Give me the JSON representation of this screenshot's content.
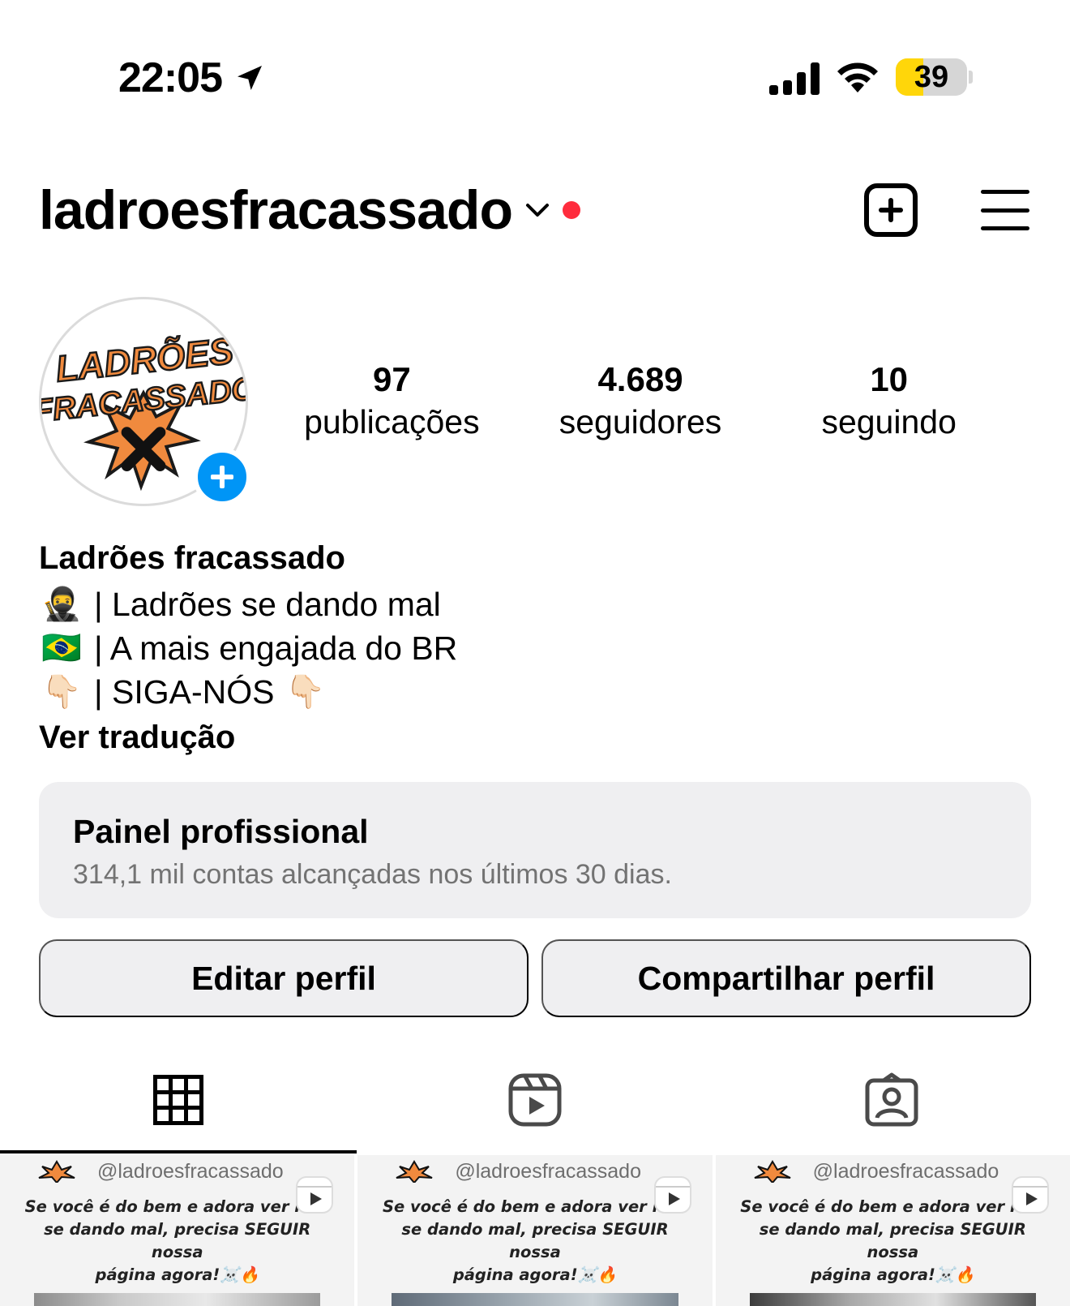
{
  "status_bar": {
    "time": "22:05",
    "battery": "39",
    "battery_level": 0.39
  },
  "header": {
    "username": "ladroesfracassado"
  },
  "profile": {
    "avatar_text": "LADRÕES FRACASSADO",
    "stats": [
      {
        "num": "97",
        "label": "publicações"
      },
      {
        "num": "4.689",
        "label": "seguidores"
      },
      {
        "num": "10",
        "label": "seguindo"
      }
    ]
  },
  "bio": {
    "name": "Ladrões fracassado",
    "lines": [
      {
        "emoji": "🥷",
        "text": "| Ladrões se dando mal",
        "emoji_after": ""
      },
      {
        "emoji": "🇧🇷",
        "text": "| A mais engajada do BR",
        "emoji_after": ""
      },
      {
        "emoji": "👇🏻",
        "text": "| SIGA-NÓS",
        "emoji_after": "👇🏻"
      }
    ],
    "translate": "Ver tradução"
  },
  "panel": {
    "title": "Painel profissional",
    "subtitle": "314,1 mil contas alcançadas nos últimos 30 dias."
  },
  "actions": {
    "edit": "Editar perfil",
    "share": "Compartilhar perfil"
  },
  "tabs": [
    {
      "icon": "grid-icon",
      "active": true
    },
    {
      "icon": "reels-icon",
      "active": false
    },
    {
      "icon": "tagged-icon",
      "active": false
    }
  ],
  "posts": [
    {
      "handle": "@ladroesfracassado",
      "caption_line1": "Se você é do bem e adora ver ladr",
      "caption_line2": "se dando mal, precisa SEGUIR nossa",
      "caption_line3": "página agora!☠️🔥"
    },
    {
      "handle": "@ladroesfracassado",
      "caption_line1": "Se você é do bem e adora ver ladr",
      "caption_line2": "se dando mal, precisa SEGUIR nossa",
      "caption_line3": "página agora!☠️🔥"
    },
    {
      "handle": "@ladroesfracassado",
      "caption_line1": "Se você é do bem e adora ver ladr",
      "caption_line2": "se dando mal, precisa SEGUIR nossa",
      "caption_line3": "página agora!☠️🔥"
    }
  ],
  "colors": {
    "accent_blue": "#0095f6",
    "notification_red": "#ff2c3d",
    "battery_yellow": "#ffd60a",
    "card_gray": "#efeff1"
  }
}
